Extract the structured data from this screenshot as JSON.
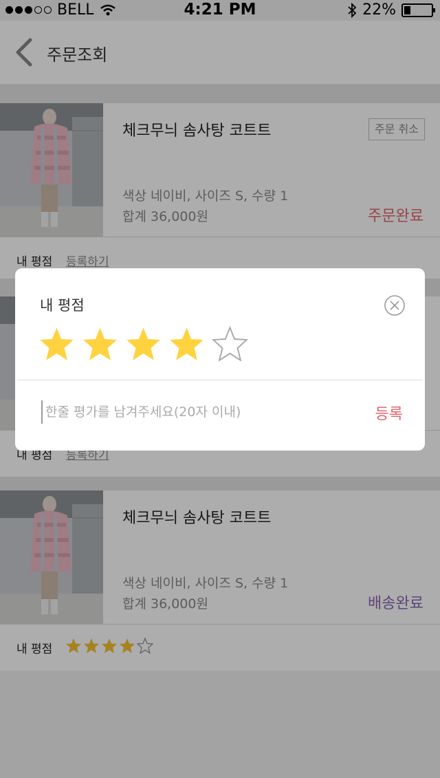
{
  "status_bar": {
    "carrier": "BELL",
    "time": "4:21 PM",
    "battery": "22%"
  },
  "header": {
    "title": "주문조회"
  },
  "orders": [
    {
      "name": "체크무늬 솜사탕 코트트",
      "cancel_label": "주문 취소",
      "options": "색상 네이비, 사이즈 S, 수량 1",
      "total": "합계 36,000원",
      "status": "주문완료",
      "status_color": "#e0656c",
      "rating_label": "내 평점",
      "rating_link": "등록하기"
    },
    {
      "rating_label": "내 평점",
      "rating_link": "등록하기"
    },
    {
      "name": "체크무늬 솜사탕 코트트",
      "options": "색상 네이비, 사이즈 S, 수량 1",
      "total": "합계 36,000원",
      "status": "배송완료",
      "status_color": "#8a64b4",
      "rating_label": "내 평점",
      "rating": 4,
      "rating_max": 5
    }
  ],
  "rating_modal": {
    "title": "내 평점",
    "rating": 4,
    "rating_max": 5,
    "placeholder": "한줄 평가를 남겨주세요(20자 이내)",
    "submit_label": "등록",
    "star_color": "#ffd340",
    "accent": "#e0656c"
  }
}
